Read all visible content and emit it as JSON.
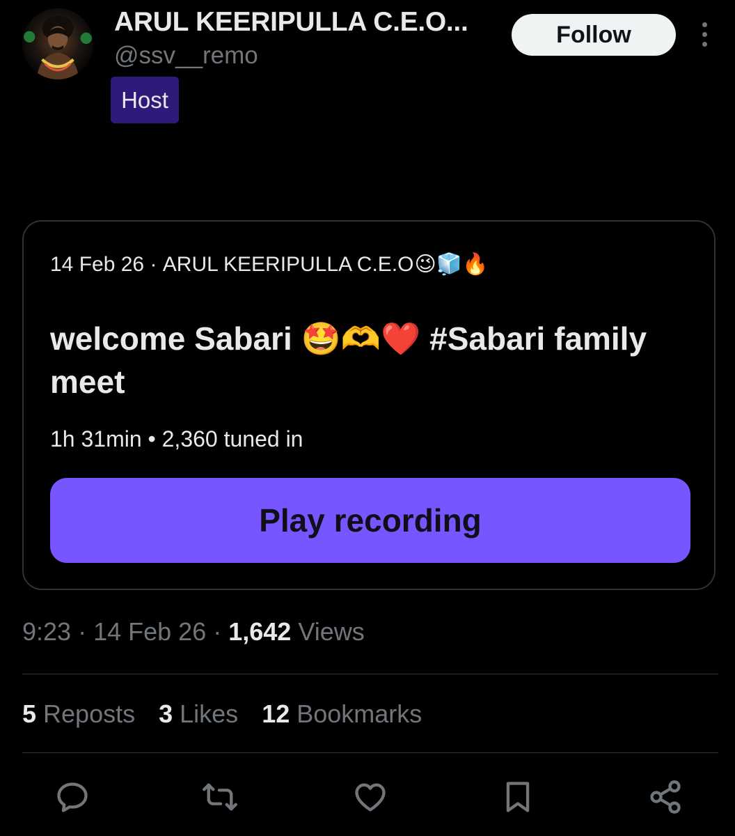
{
  "header": {
    "display_name": "ARUL KEERIPULLA C.E.O...",
    "handle": "@ssv__remo",
    "role_badge": "Host",
    "follow_label": "Follow"
  },
  "space": {
    "date": "14 Feb 26",
    "host_name": "ARUL KEERIPULLA C.E.O",
    "host_emojis": "😉🧊🔥",
    "title": "welcome Sabari 🤩🫶❤️ #Sabari family meet",
    "duration": "1h 31min",
    "tuned_in": "2,360 tuned in",
    "play_label": "Play recording"
  },
  "post_meta": {
    "time": "9:23",
    "date": "14 Feb 26",
    "views_count": "1,642",
    "views_label": "Views"
  },
  "engagement": {
    "reposts_count": "5",
    "reposts_label": "Reposts",
    "likes_count": "3",
    "likes_label": "Likes",
    "bookmarks_count": "12",
    "bookmarks_label": "Bookmarks"
  },
  "actions": [
    "reply-icon",
    "repost-icon",
    "like-icon",
    "bookmark-icon",
    "share-icon"
  ],
  "colors": {
    "background": "#000000",
    "text_primary": "#e7e9ea",
    "text_secondary": "#71767b",
    "accent_purple": "#7856ff",
    "host_badge_bg": "#2f1a7a",
    "border": "#2f3336"
  }
}
